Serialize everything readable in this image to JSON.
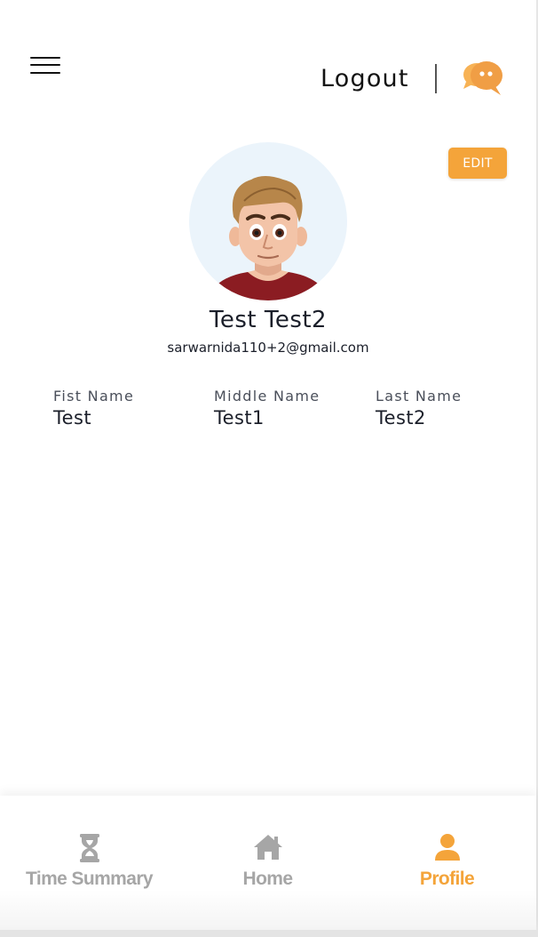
{
  "header": {
    "logout_label": "Logout"
  },
  "profile": {
    "edit_label": "EDIT",
    "display_name": "Test Test2",
    "email": "sarwarnida110+2@gmail.com",
    "fields": [
      {
        "label": "Fist Name",
        "value": "Test"
      },
      {
        "label": "Middle Name",
        "value": "Test1"
      },
      {
        "label": "Last Name",
        "value": "Test2"
      }
    ]
  },
  "bottom_nav": {
    "items": [
      {
        "label": "Time Summary",
        "icon": "hourglass-icon",
        "active": false
      },
      {
        "label": "Home",
        "icon": "home-icon",
        "active": false
      },
      {
        "label": "Profile",
        "icon": "user-icon",
        "active": true
      }
    ]
  },
  "colors": {
    "accent": "#f4a43a",
    "inactive": "#a6a6a6",
    "avatar_bg": "#ebf4fb",
    "text": "#1b1f2a"
  }
}
